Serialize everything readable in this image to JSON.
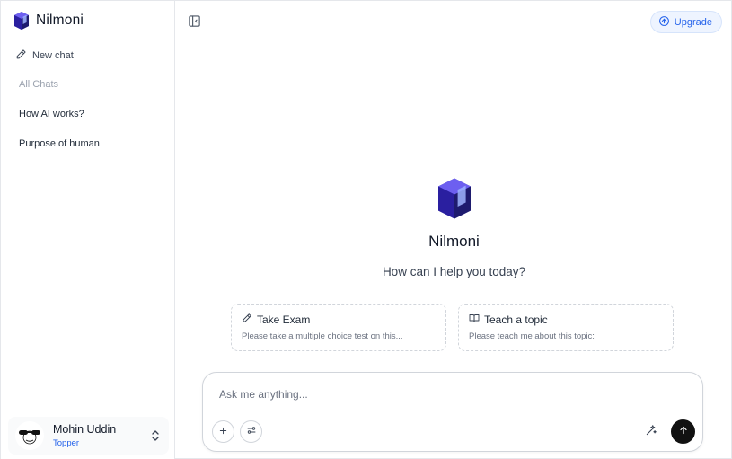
{
  "brand": {
    "name": "Nilmoni",
    "accent": "#3b2fc9"
  },
  "sidebar": {
    "new_chat_label": "New chat",
    "section_label": "All Chats",
    "chats": [
      {
        "label": "How AI works?"
      },
      {
        "label": "Purpose of human"
      }
    ],
    "user": {
      "name": "Mohin Uddin",
      "plan": "Topper",
      "plan_color": "#2563eb"
    }
  },
  "header": {
    "upgrade_label": "Upgrade"
  },
  "hero": {
    "title": "Nilmoni",
    "subtitle": "How can I help you today?"
  },
  "suggestions": [
    {
      "title": "Take Exam",
      "description": "Please take a multiple choice test on this...",
      "icon": "pencil-icon"
    },
    {
      "title": "Teach a topic",
      "description": "Please teach me about this topic:",
      "icon": "book-open-icon"
    }
  ],
  "composer": {
    "placeholder": "Ask me anything..."
  },
  "icons": {
    "sidebar_toggle": "sidebar-toggle-icon",
    "new_chat": "pencil-icon",
    "upgrade": "arrow-up-circle-icon",
    "user_menu": "chevrons-up-down-icon",
    "attach": "plus-icon",
    "tools": "sliders-icon",
    "enhance": "sparkles-icon",
    "send": "arrow-up-icon"
  }
}
